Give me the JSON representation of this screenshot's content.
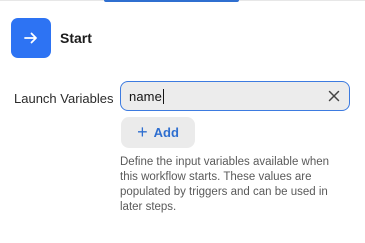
{
  "node": {
    "title": "Start",
    "icon": "arrow-right-icon",
    "accent_color": "#2d73f3"
  },
  "launch_variables": {
    "label": "Launch Variables",
    "input_value": "name",
    "clear_icon": "close-icon",
    "add_label": "Add",
    "add_icon": "plus-icon",
    "help_text": "Define the input variables available when this workflow starts. These values are populated by triggers and can be used in later steps."
  }
}
